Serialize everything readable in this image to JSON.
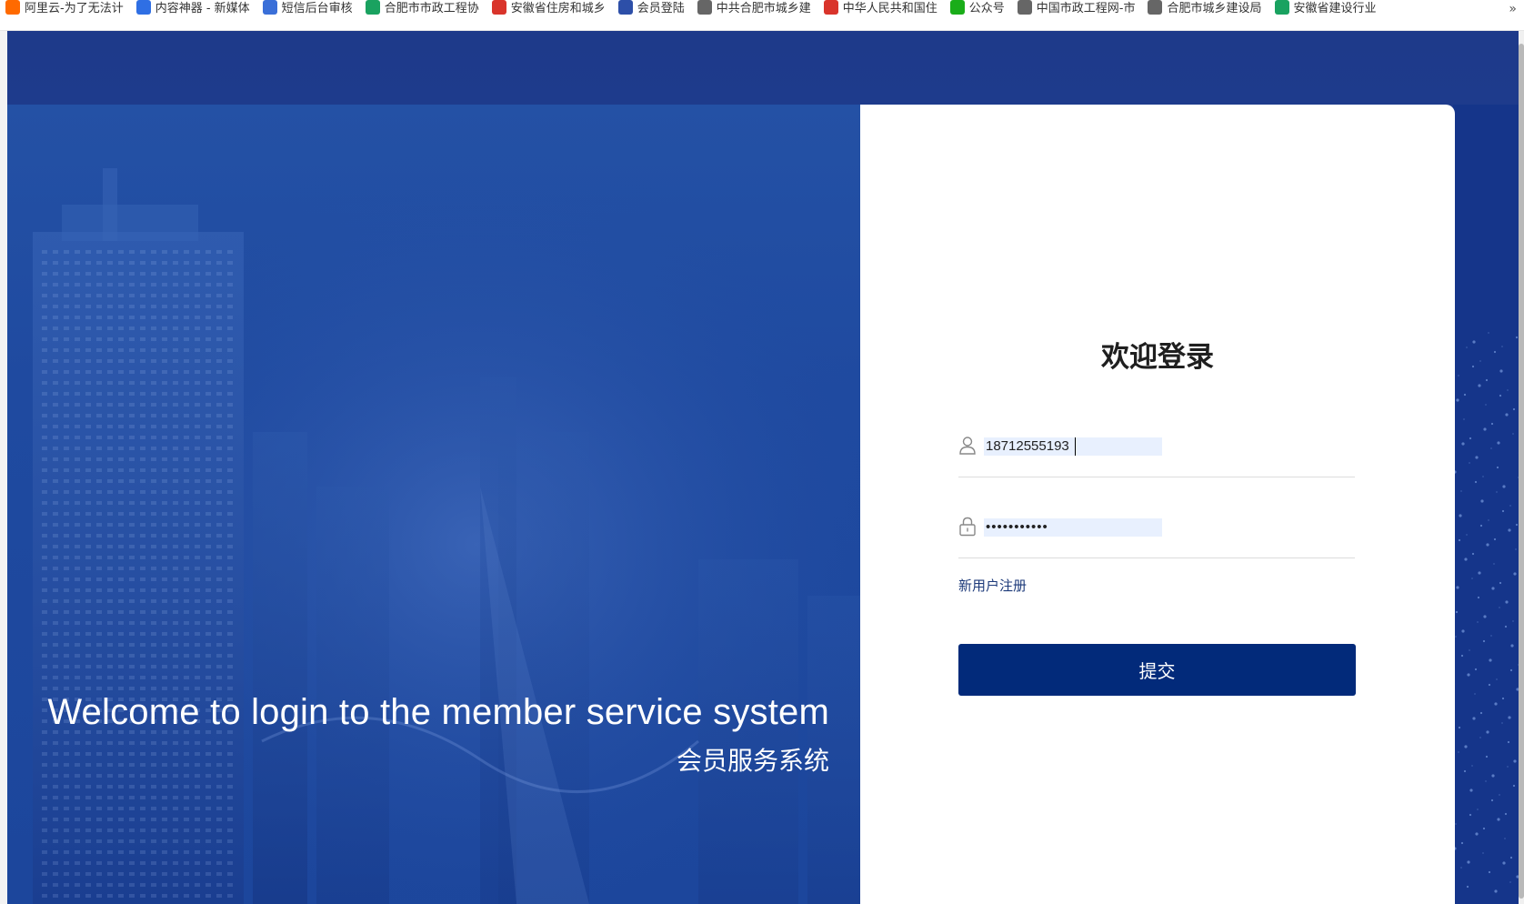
{
  "bookmarks": {
    "items": [
      {
        "label": "阿里云-为了无法计",
        "color": "#ff6a00",
        "icon": "aliyun-icon"
      },
      {
        "label": "内容神器 - 新媒体",
        "color": "#2f6fe4",
        "icon": "content-icon"
      },
      {
        "label": "短信后台审核",
        "color": "#3a6fd8",
        "icon": "sms-icon"
      },
      {
        "label": "合肥市市政工程协",
        "color": "#1aa260",
        "icon": "v-icon"
      },
      {
        "label": "安徽省住房和城乡",
        "color": "#d9342b",
        "icon": "gov-icon"
      },
      {
        "label": "会员登陆",
        "color": "#2d4fa8",
        "icon": "member-icon"
      },
      {
        "label": "中共合肥市城乡建",
        "color": "#666666",
        "icon": "globe-icon"
      },
      {
        "label": "中华人民共和国住",
        "color": "#d9342b",
        "icon": "emblem-icon"
      },
      {
        "label": "公众号",
        "color": "#1aad19",
        "icon": "wechat-icon"
      },
      {
        "label": "中国市政工程网-市",
        "color": "#666666",
        "icon": "globe-icon"
      },
      {
        "label": "合肥市城乡建设局",
        "color": "#666666",
        "icon": "globe-icon"
      },
      {
        "label": "安徽省建设行业",
        "color": "#1aa260",
        "icon": "shield-icon"
      }
    ],
    "more": "»"
  },
  "hero": {
    "welcome_en": "Welcome to login to the member service system",
    "welcome_cn": "会员服务系统"
  },
  "login": {
    "title": "欢迎登录",
    "username_value": "18712555193",
    "password_value": "•••••••••••",
    "register_label": "新用户注册",
    "submit_label": "提交"
  },
  "colors": {
    "primary": "#022a7a",
    "link": "#1d3a7a",
    "hero_blue": "#2451a5",
    "autofill": "#e8f0fe"
  }
}
